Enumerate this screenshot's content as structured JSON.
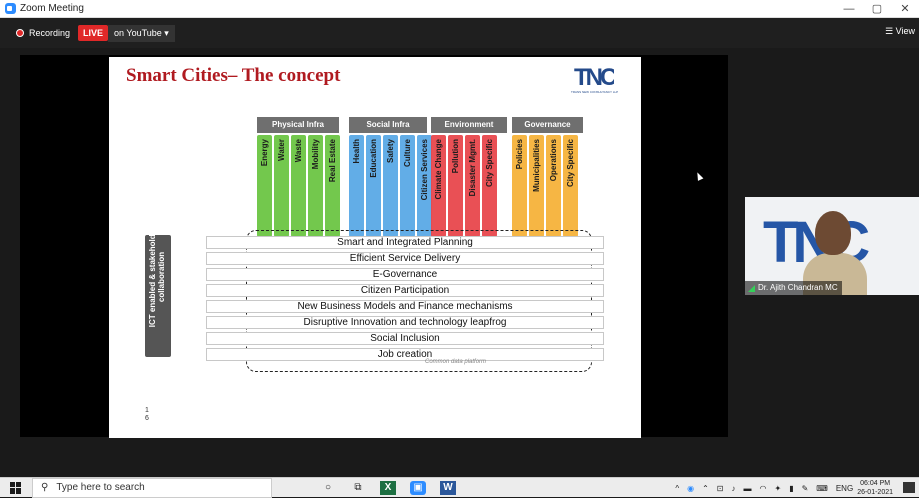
{
  "window": {
    "title": "Zoom Meeting",
    "controls": [
      "—",
      "▢",
      "✕"
    ]
  },
  "topbar": {
    "recording_label": "Recording",
    "live_label": "LIVE",
    "stream_label": "on YouTube ▾",
    "view_label": "View"
  },
  "slide": {
    "title": "Smart Cities– The concept",
    "logo_text": "TNC",
    "logo_sub": "TRANS NEW CONSULTANCY LLP",
    "page_number": "1\n6",
    "categories": [
      "Physical Infra",
      "Social Infra",
      "Environment",
      "Governance"
    ],
    "columns": [
      {
        "label": "Energy",
        "color": "#6cc644"
      },
      {
        "label": "Water",
        "color": "#6cc644"
      },
      {
        "label": "Waste",
        "color": "#6cc644"
      },
      {
        "label": "Mobility",
        "color": "#6cc644"
      },
      {
        "label": "Real Estate",
        "color": "#6cc644"
      },
      {
        "label": "Health",
        "color": "#5aa9e6"
      },
      {
        "label": "Education",
        "color": "#5aa9e6"
      },
      {
        "label": "Safety",
        "color": "#5aa9e6"
      },
      {
        "label": "Culture",
        "color": "#5aa9e6"
      },
      {
        "label": "Citizen Services",
        "color": "#5aa9e6"
      },
      {
        "label": "Climate Change",
        "color": "#e8474c"
      },
      {
        "label": "Pollution",
        "color": "#e8474c"
      },
      {
        "label": "Disaster Mgmt.",
        "color": "#e8474c"
      },
      {
        "label": "City Specific",
        "color": "#e8474c"
      },
      {
        "label": "Policies",
        "color": "#f6b33a"
      },
      {
        "label": "Municipalities",
        "color": "#f6b33a"
      },
      {
        "label": "Operations",
        "color": "#f6b33a"
      },
      {
        "label": "City Specific",
        "color": "#f6b33a"
      }
    ],
    "vertical_label": "ICT enabled & stakeholder collaboration",
    "rows": [
      "Smart and Integrated Planning",
      "Efficient Service Delivery",
      "E-Governance",
      "Citizen Participation",
      "New Business Models and Finance mechanisms",
      "Disruptive Innovation and technology leapfrog",
      "Social Inclusion",
      "Job creation"
    ],
    "platform_label": "Common data platform"
  },
  "video": {
    "name": "Dr. Ajith Chandran MC",
    "bg_logo": "TNC"
  },
  "taskbar": {
    "search_placeholder": "Type here to search",
    "language": "ENG",
    "time": "06:04 PM",
    "date": "26-01-2021"
  }
}
